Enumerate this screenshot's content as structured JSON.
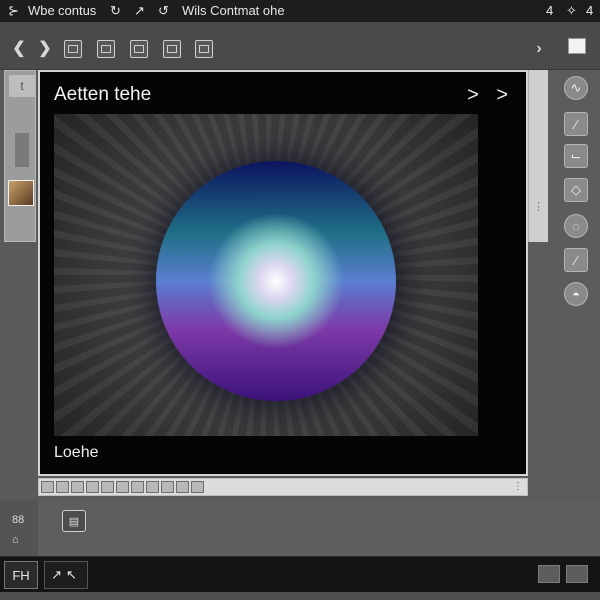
{
  "titlebar": {
    "items": [
      "⊱",
      "Wbe",
      "contus",
      "↻",
      "↗",
      "↺",
      "Wils Contmat ohe"
    ],
    "right_icons": [
      "4",
      "✧",
      "4"
    ]
  },
  "toolbar": {
    "icons": [
      "undo-arrow-icon",
      "forward-arrow-icon",
      "image-icon",
      "frame-icon",
      "grid-icon",
      "layers-icon",
      "adjust-icon"
    ],
    "next_glyph": "›"
  },
  "panel": {
    "title": "Aetten tehe",
    "nav": "> >",
    "caption": "Loehe"
  },
  "palette": {
    "icons": [
      "brush-icon",
      "line-icon",
      "corner-icon",
      "eraser-icon",
      "lasso-icon",
      "slash-tool-icon",
      "hand-icon"
    ]
  },
  "left_strip": {
    "label": "t"
  },
  "lower": {
    "icon_top": "88",
    "icon_bottom": "⌂",
    "button_glyph": "▤"
  },
  "statusbar": {
    "left_label": "FH",
    "tools_label": "↗↖"
  },
  "colors": {
    "titlebar": "#1d1d1d",
    "toolbar": "#4a4a4a",
    "panel": "#050505",
    "status": "#141414"
  }
}
